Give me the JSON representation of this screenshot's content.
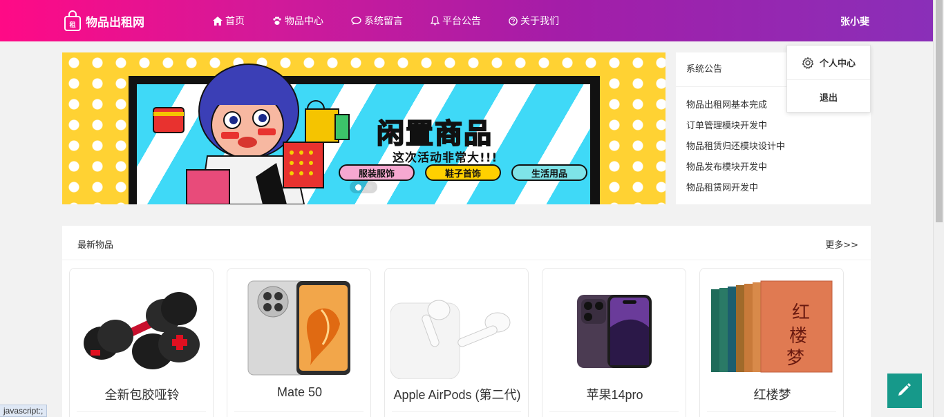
{
  "brand": {
    "title": "物品出租网",
    "logo_glyph": "租"
  },
  "nav": [
    {
      "label": "首页",
      "icon": "home-icon"
    },
    {
      "label": "物品中心",
      "icon": "paw-icon"
    },
    {
      "label": "系统留言",
      "icon": "chat-icon"
    },
    {
      "label": "平台公告",
      "icon": "bell-icon"
    },
    {
      "label": "关于我们",
      "icon": "question-icon"
    }
  ],
  "user": {
    "name": "张小斐"
  },
  "dropdown": {
    "profile": "个人中心",
    "logout": "退出"
  },
  "banner": {
    "title": "闲置商品",
    "subtitle": "这次活动非常大!!!",
    "tags": [
      "服装服饰",
      "鞋子首饰",
      "生活用品"
    ],
    "active_slide": 1,
    "slides": 2
  },
  "notice": {
    "title": "系统公告",
    "items": [
      "物品出租网基本完成",
      "订单管理模块开发中",
      "物品租赁归还模块设计中",
      "物品发布模块开发中",
      "物品租赁网开发中"
    ]
  },
  "latest": {
    "title": "最新物品",
    "more": "更多>>",
    "items": [
      {
        "name": "全新包胶哑铃",
        "image": "dumbbell-image"
      },
      {
        "name": "Mate 50",
        "image": "phone-image"
      },
      {
        "name": "Apple AirPods (第二代)",
        "image": "earbuds-image"
      },
      {
        "name": "苹果14pro",
        "image": "iphone-image"
      },
      {
        "name": "红楼梦",
        "image": "book-set-image"
      }
    ]
  },
  "statusbar": {
    "text": "javascript:;"
  },
  "colors": {
    "header_start": "#ff0a86",
    "header_end": "#8a2fb8",
    "fab": "#16998a"
  }
}
